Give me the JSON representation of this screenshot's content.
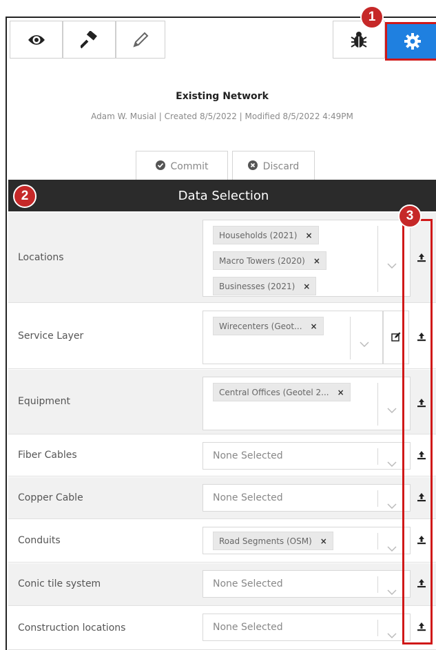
{
  "toolbar": {
    "icons": [
      "eye-icon",
      "gavel-icon",
      "pencil-icon",
      "bug-icon",
      "gear-icon"
    ],
    "accent_color": "#1f80e0",
    "highlight_color": "#d01818"
  },
  "badges": {
    "one": "1",
    "two": "2",
    "three": "3"
  },
  "plan": {
    "title": "Existing Network",
    "meta": "Adam W. Musial | Created 8/5/2022 | Modified 8/5/2022 4:49PM"
  },
  "actions": {
    "commit": "Commit",
    "discard": "Discard"
  },
  "section": {
    "title": "Data Selection"
  },
  "rows": [
    {
      "label": "Locations",
      "chips": [
        "Households (2021)",
        "Macro Towers (2020)",
        "Businesses (2021)"
      ]
    },
    {
      "label": "Service Layer",
      "chips": [
        "Wirecenters (Geot..."
      ]
    },
    {
      "label": "Equipment",
      "chips": [
        "Central Offices (Geotel 2..."
      ]
    },
    {
      "label": "Fiber Cables",
      "placeholder": "None Selected"
    },
    {
      "label": "Copper Cable",
      "placeholder": "None Selected"
    },
    {
      "label": "Conduits",
      "chips": [
        "Road Segments (OSM)"
      ]
    },
    {
      "label": "Conic tile system",
      "placeholder": "None Selected"
    },
    {
      "label": "Construction locations",
      "placeholder": "None Selected"
    }
  ]
}
